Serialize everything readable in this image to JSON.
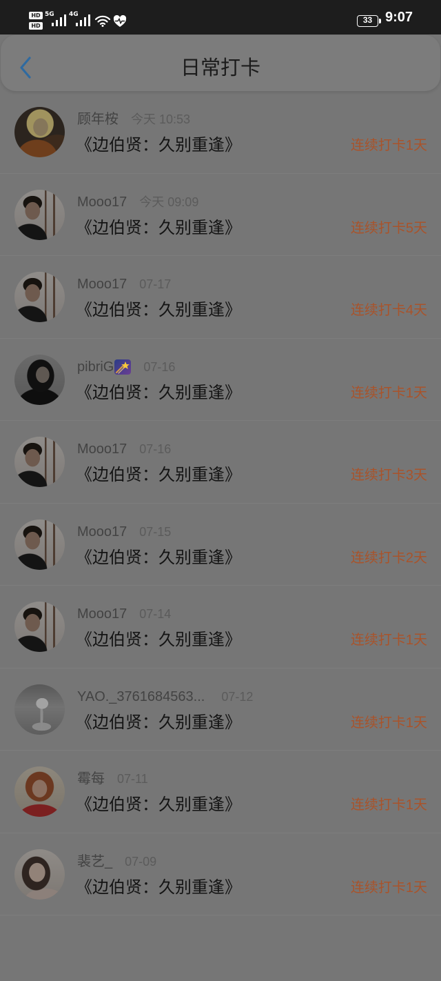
{
  "status_bar": {
    "hd_top": "HD",
    "hd_bottom": "HD",
    "net_1": "5G",
    "net_2": "4G",
    "battery": "33",
    "time": "9:07",
    "icons": [
      "signal-icon",
      "wifi-icon",
      "health-icon",
      "battery-icon"
    ]
  },
  "header": {
    "title": "日常打卡",
    "back_icon": "chevron-left-icon"
  },
  "theme": {
    "background": "#767676",
    "header_bg": "#7c7c7c",
    "status_bar": "#1d1d1d",
    "accent": "#2f6aa0",
    "streak": "#a9532a"
  },
  "checkins": [
    {
      "user": "顾年桉",
      "time": "今天 10:53",
      "book": "《边伯贤：久别重逢》",
      "streak": "连续打卡1天"
    },
    {
      "user": "Mooo17",
      "time": "今天 09:09",
      "book": "《边伯贤：久别重逢》",
      "streak": "连续打卡5天"
    },
    {
      "user": "Mooo17",
      "time": "07-17",
      "book": "《边伯贤：久别重逢》",
      "streak": "连续打卡4天"
    },
    {
      "user": "pibriG",
      "badge_icon": "shooting-star-icon",
      "time": "07-16",
      "book": "《边伯贤：久别重逢》",
      "streak": "连续打卡1天"
    },
    {
      "user": "Mooo17",
      "time": "07-16",
      "book": "《边伯贤：久别重逢》",
      "streak": "连续打卡3天"
    },
    {
      "user": "Mooo17",
      "time": "07-15",
      "book": "《边伯贤：久别重逢》",
      "streak": "连续打卡2天"
    },
    {
      "user": "Mooo17",
      "time": "07-14",
      "book": "《边伯贤：久别重逢》",
      "streak": "连续打卡1天"
    },
    {
      "user": "YAO._3761684563...",
      "time": "07-12",
      "book": "《边伯贤：久别重逢》",
      "streak": "连续打卡1天"
    },
    {
      "user": "霉每",
      "time": "07-11",
      "book": "《边伯贤：久别重逢》",
      "streak": "连续打卡1天"
    },
    {
      "user": "裴艺_",
      "time": "07-09",
      "book": "《边伯贤：久别重逢》",
      "streak": "连续打卡1天"
    }
  ]
}
